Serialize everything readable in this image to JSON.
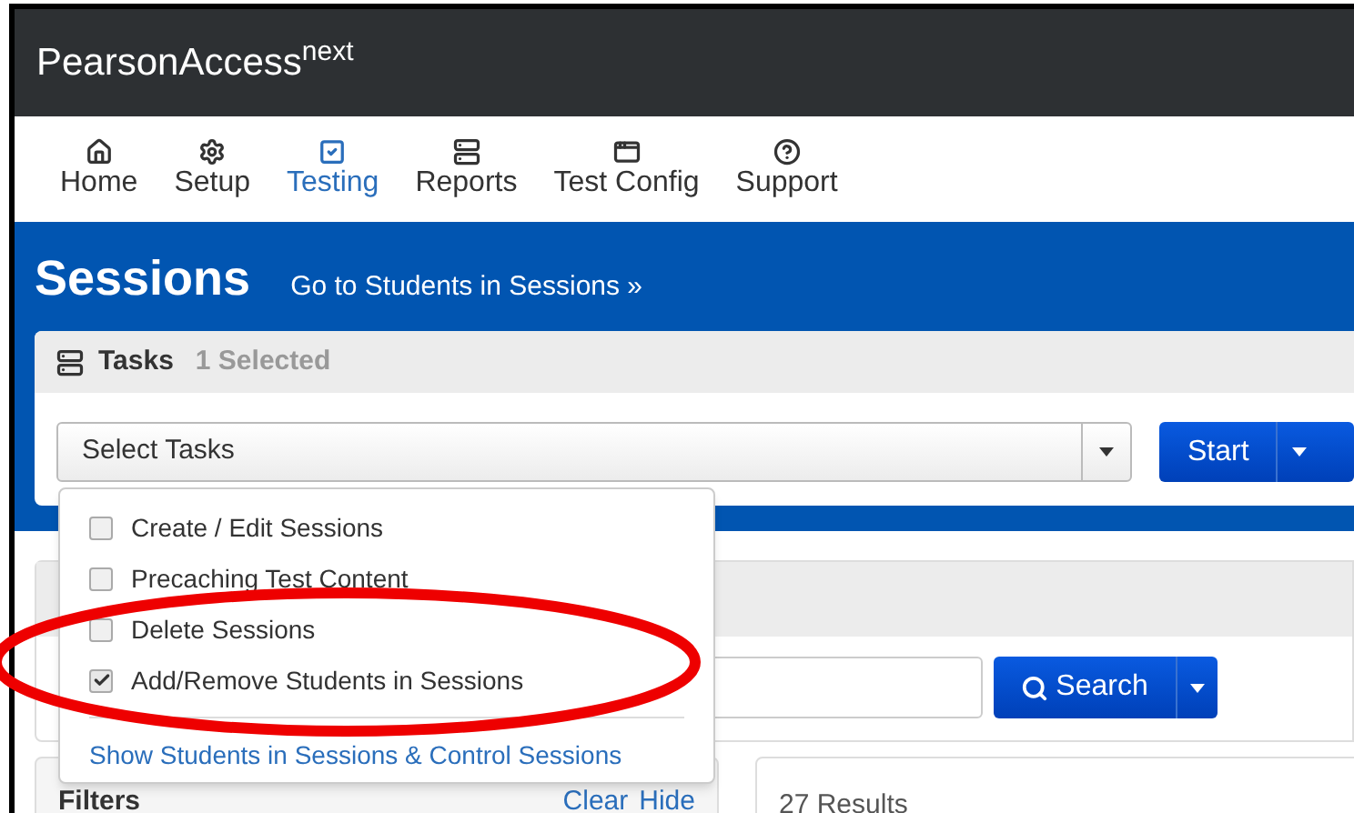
{
  "brand": {
    "name": "PearsonAccess",
    "superscript": "next"
  },
  "nav": [
    {
      "label": "Home",
      "selected": false
    },
    {
      "label": "Setup",
      "selected": false
    },
    {
      "label": "Testing",
      "selected": true
    },
    {
      "label": "Reports",
      "selected": false
    },
    {
      "label": "Test Config",
      "selected": false
    },
    {
      "label": "Support",
      "selected": false
    }
  ],
  "page": {
    "title": "Sessions",
    "link": "Go to Students in Sessions »"
  },
  "tasks": {
    "title": "Tasks",
    "count": "1 Selected",
    "select_placeholder": "Select Tasks",
    "start_button": "Start"
  },
  "task_menu": {
    "items": [
      {
        "label": "Create / Edit Sessions",
        "checked": false
      },
      {
        "label": "Precaching Test Content",
        "checked": false
      },
      {
        "label": "Delete Sessions",
        "checked": false
      },
      {
        "label": "Add/Remove Students in Sessions",
        "checked": true
      }
    ],
    "link": "Show Students in Sessions & Control Sessions"
  },
  "search": {
    "button": "Search"
  },
  "filters": {
    "title": "Filters",
    "clear": "Clear",
    "hide": "Hide"
  },
  "results": {
    "count": "27 Results"
  },
  "annotation": {
    "highlight": true
  }
}
